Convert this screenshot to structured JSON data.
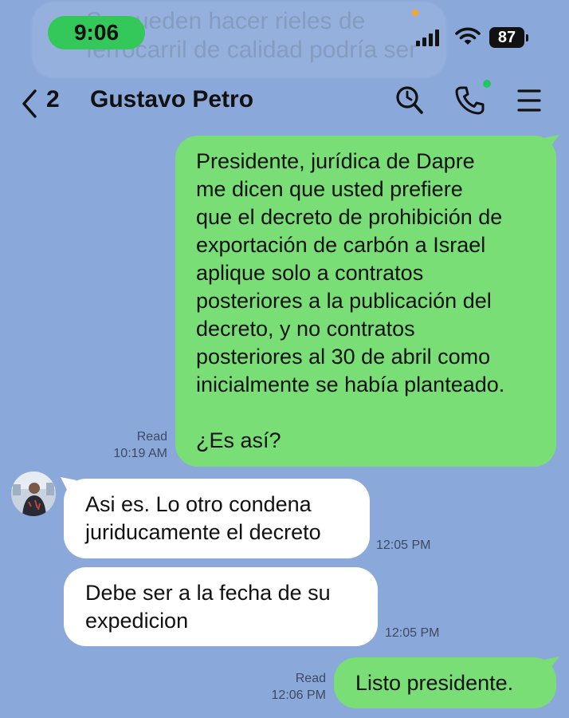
{
  "status_bar": {
    "time": "9:06",
    "battery": "87"
  },
  "background_preview": {
    "line1": "Se pueden hacer rieles de",
    "line2": "ferrocarril de calidad podría ser"
  },
  "header": {
    "back_count": "2",
    "contact_name": "Gustavo Petro"
  },
  "messages": [
    {
      "direction": "outgoing",
      "text": "Presidente, jurídica de Dapre\nme dicen que usted prefiere\nque el decreto de prohibición de\nexportación de carbón a Israel\naplique solo a contratos\nposteriores a la publicación del\ndecreto, y no contratos\nposteriores al 30 de abril como\ninicialmente se había planteado.\n\n¿Es así?",
      "status": "Read",
      "time": "10:19 AM"
    },
    {
      "direction": "incoming",
      "text": "Asi es. Lo otro condena\njuriducamente el decreto",
      "time": "12:05 PM"
    },
    {
      "direction": "incoming",
      "text": "Debe ser a la fecha de su\nexpedicion",
      "time": "12:05 PM"
    },
    {
      "direction": "outgoing",
      "text": "Listo presidente.",
      "status": "Read",
      "time": "12:06 PM"
    }
  ],
  "colors": {
    "background": "#8aa8d9",
    "outgoing_bubble": "#79de75",
    "incoming_bubble": "#ffffff",
    "time_pill": "#34c759",
    "call_dot": "#20c760"
  },
  "icons": [
    "back-chevron-icon",
    "search-icon",
    "phone-icon",
    "menu-icon",
    "wifi-icon",
    "signal-icon",
    "battery-icon"
  ]
}
